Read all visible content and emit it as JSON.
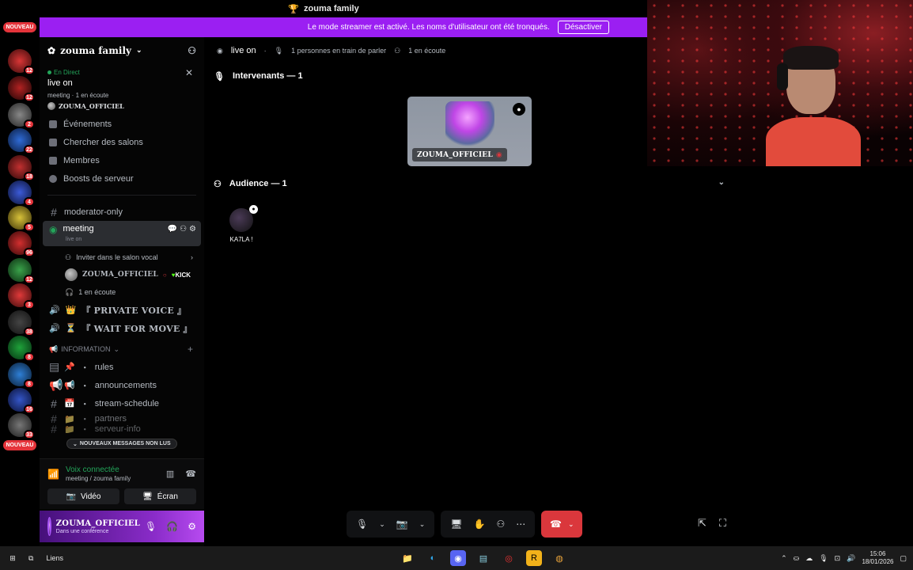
{
  "app": {
    "title_icon": "trophy-icon",
    "title": "zouma family"
  },
  "banner": {
    "text": "Le mode streamer est activé. Les noms d'utilisateur ont été tronqués.",
    "button": "Désactiver"
  },
  "rail": {
    "new_label": "NOUVEAU",
    "badges": [
      "12",
      "12",
      "2",
      "22",
      "18",
      "4",
      "5",
      "96",
      "12",
      "3",
      "38",
      "8",
      "8",
      "16",
      "33"
    ]
  },
  "sidebar": {
    "server_name": "zouma family",
    "live": {
      "tag": "En Direct",
      "title": "live on",
      "meta": "meeting · 1 en écoute",
      "user": "ZOUMA_OFFICIEL"
    },
    "nav": [
      {
        "label": "Événements",
        "icon": "calendar-icon"
      },
      {
        "label": "Chercher des salons",
        "icon": "list-search-icon"
      },
      {
        "label": "Membres",
        "icon": "members-icon"
      },
      {
        "label": "Boosts de serveur",
        "icon": "boost-icon"
      }
    ],
    "moderator_channel": "moderator-only",
    "meeting": {
      "name": "meeting",
      "sub": "live on"
    },
    "voice_rows": {
      "invite": "Inviter dans le salon vocal",
      "user": "ZOUMA_OFFICIEL",
      "kick": "KICK",
      "listening": "1 en écoute"
    },
    "private_voice": "『 PRIVATE VOICE 』",
    "wait_for_move": "『 WAIT FOR MOVE 』",
    "category": "INFORMATION",
    "info_channels": [
      {
        "label": "rules",
        "emoji": "📌"
      },
      {
        "label": "announcements",
        "emoji": "📢"
      },
      {
        "label": "stream-schedule",
        "emoji": "📅"
      },
      {
        "label": "partners",
        "emoji": "📁"
      },
      {
        "label": "serveur-info",
        "emoji": "📁"
      }
    ],
    "unread_pill": "NOUVEAUX MESSAGES NON LUS",
    "voice_panel": {
      "status": "Voix connectée",
      "sub": "meeting / zouma family",
      "video_label": "Vidéo",
      "screen_label": "Écran"
    },
    "user_bar": {
      "name": "ZOUMA_OFFICIEL",
      "status": "Dans une conférence"
    }
  },
  "stage": {
    "header_title": "live on",
    "speakers_count_text": "1 personnes en train de parler",
    "listeners_text": "1 en écoute",
    "speakers_heading": "Intervenants — 1",
    "speaker_name": "ZOUMA_OFFICIEL",
    "audience_heading": "Audience — 1",
    "audience_member": "KA7LA !"
  },
  "taskbar": {
    "links_label": "Liens",
    "time": "15:06",
    "date": "18/01/2026"
  },
  "colors": {
    "banner": "#9b1ff2",
    "online": "#23a55a",
    "danger": "#da373c",
    "badge": "#e5343b"
  }
}
